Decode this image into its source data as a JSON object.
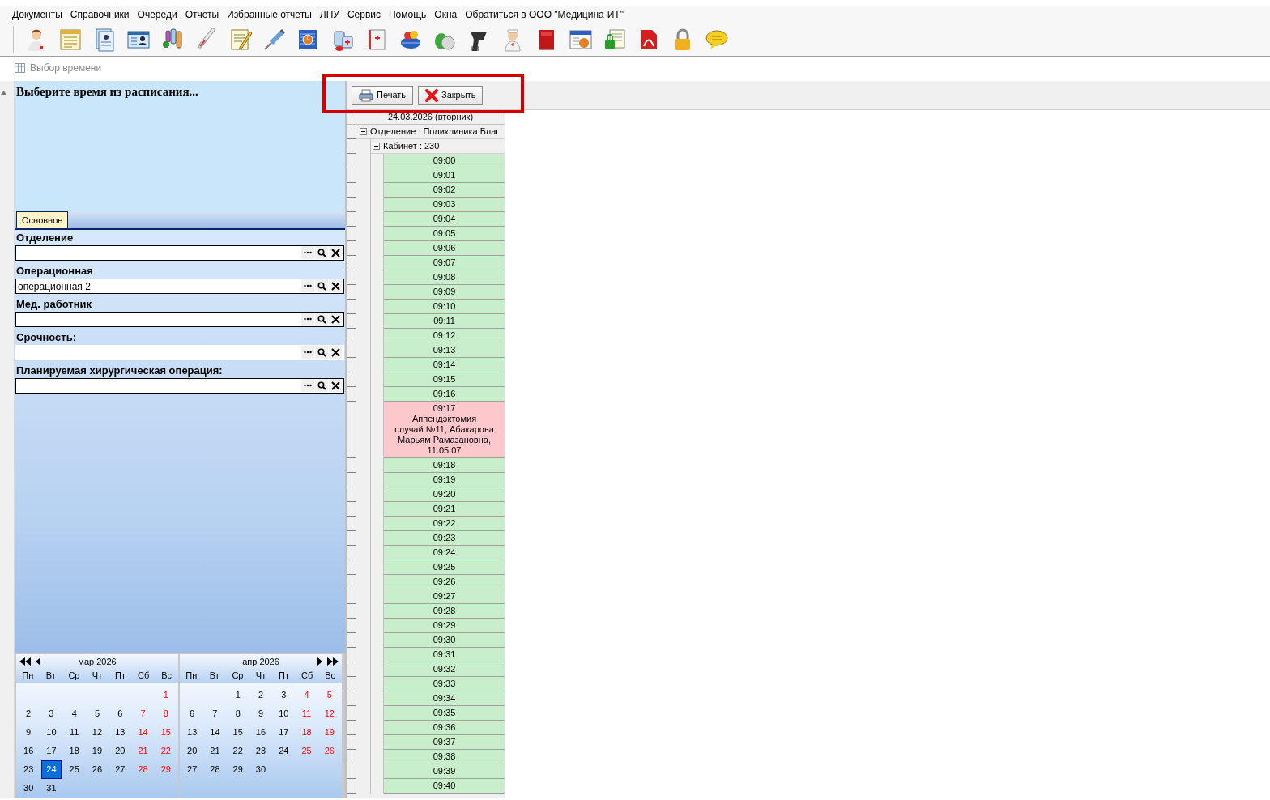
{
  "menu": [
    "Документы",
    "Справочники",
    "Очереди",
    "Отчеты",
    "Избранные отчеты",
    "ЛПУ",
    "Сервис",
    "Помощь",
    "Окна",
    "Обратиться в ООО \"Медицина-ИТ\""
  ],
  "caption": "Выбор времени",
  "prompt": "Выберите время из расписания...",
  "tabs": [
    {
      "label": "Основное",
      "selected": true
    }
  ],
  "fields": [
    {
      "label": "Отделение",
      "framed": true
    },
    {
      "label": "Операционная",
      "value": "операционная 2",
      "framed": true
    },
    {
      "label": "Мед. работник",
      "framed": true
    },
    {
      "label": "Срочность:",
      "framed": false
    },
    {
      "label": "Планируемая хирургическая операция:",
      "framed": true
    }
  ],
  "calendars": [
    {
      "title": "мар 2026",
      "kind": "previous",
      "weekdays": [
        "Пн",
        "Вт",
        "Ср",
        "Чт",
        "Пт",
        "Сб",
        "Вс"
      ],
      "weeks": [
        [
          {
            "kind": "blank"
          },
          {
            "kind": "blank"
          },
          {
            "kind": "blank"
          },
          {
            "kind": "blank"
          },
          {
            "kind": "blank"
          },
          {
            "kind": "blank"
          },
          {
            "kind": "day",
            "day": "1",
            "weekend": true,
            "selected": false
          }
        ],
        [
          {
            "kind": "day",
            "day": "2",
            "weekend": false,
            "selected": false
          },
          {
            "kind": "day",
            "day": "3",
            "weekend": false,
            "selected": false
          },
          {
            "kind": "day",
            "day": "4",
            "weekend": false,
            "selected": false
          },
          {
            "kind": "day",
            "day": "5",
            "weekend": false,
            "selected": false
          },
          {
            "kind": "day",
            "day": "6",
            "weekend": false,
            "selected": false
          },
          {
            "kind": "day",
            "day": "7",
            "weekend": true,
            "selected": false
          },
          {
            "kind": "day",
            "day": "8",
            "weekend": true,
            "selected": false
          }
        ],
        [
          {
            "kind": "day",
            "day": "9",
            "weekend": false,
            "selected": false
          },
          {
            "kind": "day",
            "day": "10",
            "weekend": false,
            "selected": false
          },
          {
            "kind": "day",
            "day": "11",
            "weekend": false,
            "selected": false
          },
          {
            "kind": "day",
            "day": "12",
            "weekend": false,
            "selected": false
          },
          {
            "kind": "day",
            "day": "13",
            "weekend": false,
            "selected": false
          },
          {
            "kind": "day",
            "day": "14",
            "weekend": true,
            "selected": false
          },
          {
            "kind": "day",
            "day": "15",
            "weekend": true,
            "selected": false
          }
        ],
        [
          {
            "kind": "day",
            "day": "16",
            "weekend": false,
            "selected": false
          },
          {
            "kind": "day",
            "day": "17",
            "weekend": false,
            "selected": false
          },
          {
            "kind": "day",
            "day": "18",
            "weekend": false,
            "selected": false
          },
          {
            "kind": "day",
            "day": "19",
            "weekend": false,
            "selected": false
          },
          {
            "kind": "day",
            "day": "20",
            "weekend": false,
            "selected": false
          },
          {
            "kind": "day",
            "day": "21",
            "weekend": true,
            "selected": false
          },
          {
            "kind": "day",
            "day": "22",
            "weekend": true,
            "selected": false
          }
        ],
        [
          {
            "kind": "day",
            "day": "23",
            "weekend": false,
            "selected": false
          },
          {
            "kind": "day",
            "day": "24",
            "weekend": false,
            "selected": true
          },
          {
            "kind": "day",
            "day": "25",
            "weekend": false,
            "selected": false
          },
          {
            "kind": "day",
            "day": "26",
            "weekend": false,
            "selected": false
          },
          {
            "kind": "day",
            "day": "27",
            "weekend": false,
            "selected": false
          },
          {
            "kind": "day",
            "day": "28",
            "weekend": true,
            "selected": false
          },
          {
            "kind": "day",
            "day": "29",
            "weekend": true,
            "selected": false
          }
        ],
        [
          {
            "kind": "day",
            "day": "30",
            "weekend": false,
            "selected": false
          },
          {
            "kind": "day",
            "day": "31",
            "weekend": false,
            "selected": false
          }
        ]
      ]
    },
    {
      "title": "апр 2026",
      "kind": "next",
      "weekdays": [
        "Пн",
        "Вт",
        "Ср",
        "Чт",
        "Пт",
        "Сб",
        "Вс"
      ],
      "weeks": [
        [
          {
            "kind": "blank"
          },
          {
            "kind": "blank"
          },
          {
            "kind": "day",
            "day": "1",
            "weekend": false,
            "selected": false
          },
          {
            "kind": "day",
            "day": "2",
            "weekend": false,
            "selected": false
          },
          {
            "kind": "day",
            "day": "3",
            "weekend": false,
            "selected": false
          },
          {
            "kind": "day",
            "day": "4",
            "weekend": true,
            "selected": false
          },
          {
            "kind": "day",
            "day": "5",
            "weekend": true,
            "selected": false
          }
        ],
        [
          {
            "kind": "day",
            "day": "6",
            "weekend": false,
            "selected": false
          },
          {
            "kind": "day",
            "day": "7",
            "weekend": false,
            "selected": false
          },
          {
            "kind": "day",
            "day": "8",
            "weekend": false,
            "selected": false
          },
          {
            "kind": "day",
            "day": "9",
            "weekend": false,
            "selected": false
          },
          {
            "kind": "day",
            "day": "10",
            "weekend": false,
            "selected": false
          },
          {
            "kind": "day",
            "day": "11",
            "weekend": true,
            "selected": false
          },
          {
            "kind": "day",
            "day": "12",
            "weekend": true,
            "selected": false
          }
        ],
        [
          {
            "kind": "day",
            "day": "13",
            "weekend": false,
            "selected": false
          },
          {
            "kind": "day",
            "day": "14",
            "weekend": false,
            "selected": false
          },
          {
            "kind": "day",
            "day": "15",
            "weekend": false,
            "selected": false
          },
          {
            "kind": "day",
            "day": "16",
            "weekend": false,
            "selected": false
          },
          {
            "kind": "day",
            "day": "17",
            "weekend": false,
            "selected": false
          },
          {
            "kind": "day",
            "day": "18",
            "weekend": true,
            "selected": false
          },
          {
            "kind": "day",
            "day": "19",
            "weekend": true,
            "selected": false
          }
        ],
        [
          {
            "kind": "day",
            "day": "20",
            "weekend": false,
            "selected": false
          },
          {
            "kind": "day",
            "day": "21",
            "weekend": false,
            "selected": false
          },
          {
            "kind": "day",
            "day": "22",
            "weekend": false,
            "selected": false
          },
          {
            "kind": "day",
            "day": "23",
            "weekend": false,
            "selected": false
          },
          {
            "kind": "day",
            "day": "24",
            "weekend": false,
            "selected": false
          },
          {
            "kind": "day",
            "day": "25",
            "weekend": true,
            "selected": false
          },
          {
            "kind": "day",
            "day": "26",
            "weekend": true,
            "selected": false
          }
        ],
        [
          {
            "kind": "day",
            "day": "27",
            "weekend": false,
            "selected": false
          },
          {
            "kind": "day",
            "day": "28",
            "weekend": false,
            "selected": false
          },
          {
            "kind": "day",
            "day": "29",
            "weekend": false,
            "selected": false
          },
          {
            "kind": "day",
            "day": "30",
            "weekend": false,
            "selected": false
          }
        ]
      ]
    }
  ],
  "actions": [
    {
      "kind": "print",
      "label": "Печать"
    },
    {
      "kind": "close",
      "label": "Закрыть"
    }
  ],
  "schedule": {
    "date": "24.03.2026 (вторник)",
    "department": {
      "label": "Отделение : Поликлиника Благ",
      "expanded": true
    },
    "room": {
      "label": "Кабинет : 230",
      "expanded": true
    },
    "slots": [
      {
        "kind": "free",
        "time": "09:00"
      },
      {
        "kind": "free",
        "time": "09:01"
      },
      {
        "kind": "free",
        "time": "09:02"
      },
      {
        "kind": "free",
        "time": "09:03"
      },
      {
        "kind": "free",
        "time": "09:04"
      },
      {
        "kind": "free",
        "time": "09:05"
      },
      {
        "kind": "free",
        "time": "09:06"
      },
      {
        "kind": "free",
        "time": "09:07"
      },
      {
        "kind": "free",
        "time": "09:08"
      },
      {
        "kind": "free",
        "time": "09:09"
      },
      {
        "kind": "free",
        "time": "09:10"
      },
      {
        "kind": "free",
        "time": "09:11"
      },
      {
        "kind": "free",
        "time": "09:12"
      },
      {
        "kind": "free",
        "time": "09:13"
      },
      {
        "kind": "free",
        "time": "09:14"
      },
      {
        "kind": "free",
        "time": "09:15"
      },
      {
        "kind": "free",
        "time": "09:16"
      },
      {
        "kind": "booked",
        "time": "09:17",
        "lines": [
          "Аппендэктомия",
          "случай №11, Абакарова",
          "Марьям Рамазановна,",
          "11.05.07"
        ]
      },
      {
        "kind": "free",
        "time": "09:18"
      },
      {
        "kind": "free",
        "time": "09:19"
      },
      {
        "kind": "free",
        "time": "09:20"
      },
      {
        "kind": "free",
        "time": "09:21"
      },
      {
        "kind": "free",
        "time": "09:22"
      },
      {
        "kind": "free",
        "time": "09:23"
      },
      {
        "kind": "free",
        "time": "09:24"
      },
      {
        "kind": "free",
        "time": "09:25"
      },
      {
        "kind": "free",
        "time": "09:26"
      },
      {
        "kind": "free",
        "time": "09:27"
      },
      {
        "kind": "free",
        "time": "09:28"
      },
      {
        "kind": "free",
        "time": "09:29"
      },
      {
        "kind": "free",
        "time": "09:30"
      },
      {
        "kind": "free",
        "time": "09:31"
      },
      {
        "kind": "free",
        "time": "09:32"
      },
      {
        "kind": "free",
        "time": "09:33"
      },
      {
        "kind": "free",
        "time": "09:34"
      },
      {
        "kind": "free",
        "time": "09:35"
      },
      {
        "kind": "free",
        "time": "09:36"
      },
      {
        "kind": "free",
        "time": "09:37"
      },
      {
        "kind": "free",
        "time": "09:38"
      },
      {
        "kind": "free",
        "time": "09:39"
      },
      {
        "kind": "free",
        "time": "09:40"
      }
    ]
  }
}
